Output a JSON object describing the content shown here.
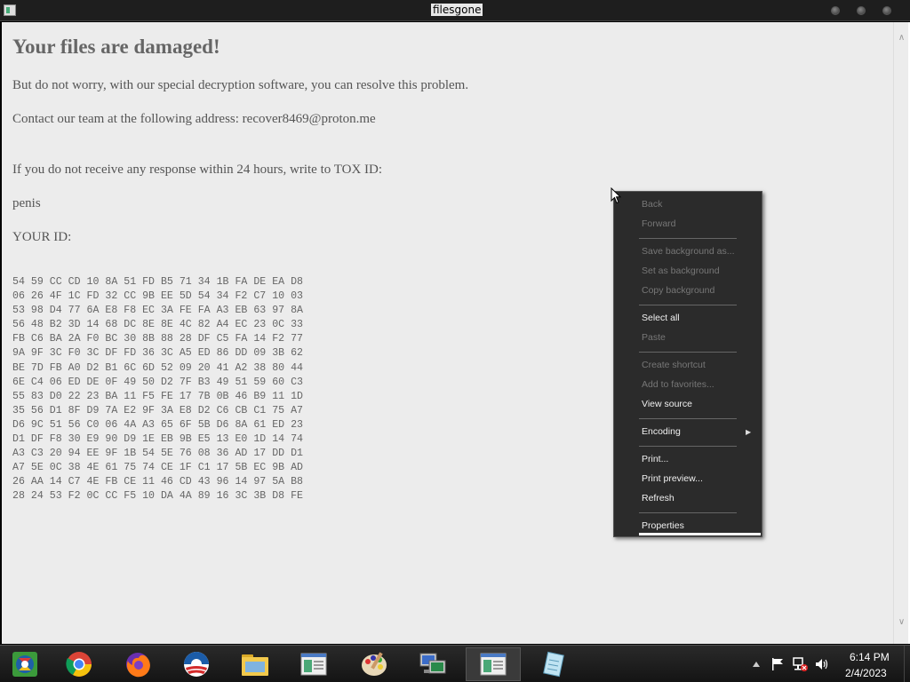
{
  "window": {
    "title": "filesgone"
  },
  "document": {
    "heading": "Your files are damaged!",
    "line1": "But do not worry, with our special decryption software, you can resolve this problem.",
    "line2": "Contact our team at the following address: recover8469@proton.me",
    "line3": "If you do not receive any response within 24 hours, write to TOX ID:",
    "line4": "penis",
    "line5": "YOUR ID:",
    "id_hex": "54 59 CC CD 10 8A 51 FD B5 71 34 1B FA DE EA D8\n06 26 4F 1C FD 32 CC 9B EE 5D 54 34 F2 C7 10 03\n53 98 D4 77 6A E8 F8 EC 3A FE FA A3 EB 63 97 8A\n56 48 B2 3D 14 68 DC 8E 8E 4C 82 A4 EC 23 0C 33\nFB C6 BA 2A F0 BC 30 8B 88 28 DF C5 FA 14 F2 77\n9A 9F 3C F0 3C DF FD 36 3C A5 ED 86 DD 09 3B 62\nBE 7D FB A0 D2 B1 6C 6D 52 09 20 41 A2 38 80 44\n6E C4 06 ED DE 0F 49 50 D2 7F B3 49 51 59 60 C3\n55 83 D0 22 23 BA 11 F5 FE 17 7B 0B 46 B9 11 1D\n35 56 D1 8F D9 7A E2 9F 3A E8 D2 C6 CB C1 75 A7\nD6 9C 51 56 C0 06 4A A3 65 6F 5B D6 8A 61 ED 23\nD1 DF F8 30 E9 90 D9 1E EB 9B E5 13 E0 1D 14 74\nA3 C3 20 94 EE 9F 1B 54 5E 76 08 36 AD 17 DD D1\nA7 5E 0C 38 4E 61 75 74 CE 1F C1 17 5B EC 9B AD\n26 AA 14 C7 4E FB CE 11 46 CD 43 96 14 97 5A B8\n28 24 53 F2 0C CC F5 10 DA 4A 89 16 3C 3B D8 FE"
  },
  "context_menu": {
    "back": "Back",
    "forward": "Forward",
    "save_background": "Save background as...",
    "set_background": "Set as background",
    "copy_background": "Copy background",
    "select_all": "Select all",
    "paste": "Paste",
    "create_shortcut": "Create shortcut",
    "add_favorites": "Add to favorites...",
    "view_source": "View source",
    "encoding": "Encoding",
    "print": "Print...",
    "print_preview": "Print preview...",
    "refresh": "Refresh",
    "properties": "Properties"
  },
  "taskbar": {
    "apps": [
      "start-orb",
      "chrome",
      "firefox",
      "obama-app",
      "file-explorer",
      "document-window",
      "paint",
      "network-window",
      "filesgone-window",
      "notepad"
    ],
    "active_app": "filesgone-window"
  },
  "tray": {
    "time": "6:14 PM",
    "date": "2/4/2023",
    "icons": [
      "chevron-up-icon",
      "flag-icon",
      "network-error-icon",
      "speaker-icon"
    ]
  },
  "colors": {
    "content_bg": "#ececec",
    "menu_bg": "#2b2b2b",
    "taskbar_bg": "#1a1a1a"
  }
}
